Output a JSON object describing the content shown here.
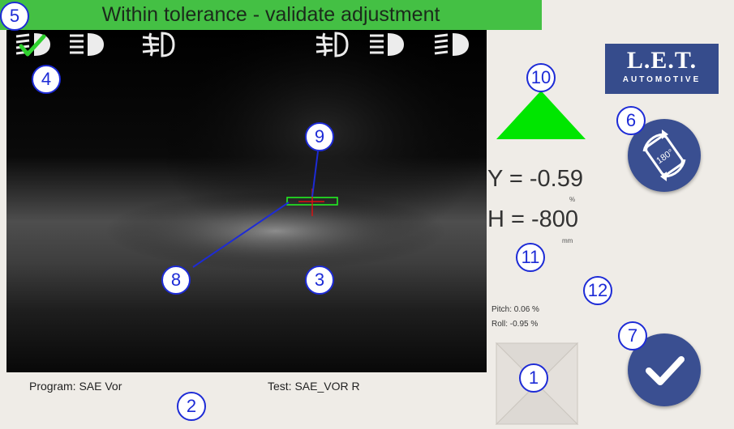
{
  "banner": {
    "text": "Within tolerance - validate adjustment",
    "color": "#44c044"
  },
  "camera": {
    "icons_left": [
      "low-beam-checked-icon",
      "high-beam-icon",
      "fog-lamp-icon"
    ],
    "icons_right": [
      "fog-lamp-icon",
      "high-beam-icon",
      "low-beam-icon"
    ],
    "program_label": "Program: SAE Vor",
    "test_label": "Test: SAE_VOR R"
  },
  "logo": {
    "main": "L.E.T.",
    "sub": "AUTOMOTIVE"
  },
  "readouts": {
    "y": "Y = -0.59",
    "y_unit": "%",
    "h": "H = -800",
    "h_unit": "mm",
    "pitch": "Pitch: 0.06 %",
    "roll": "Roll: -0.95 %"
  },
  "markers": {
    "m1": "1",
    "m2": "2",
    "m3": "3",
    "m4": "4",
    "m5": "5",
    "m6": "6",
    "m7": "7",
    "m8": "8",
    "m9": "9",
    "m10": "10",
    "m11": "11",
    "m12": "12"
  },
  "colors": {
    "accent_blue": "#3a4f91",
    "indicator_green": "#00e600",
    "marker_blue": "#1d2bd6"
  }
}
